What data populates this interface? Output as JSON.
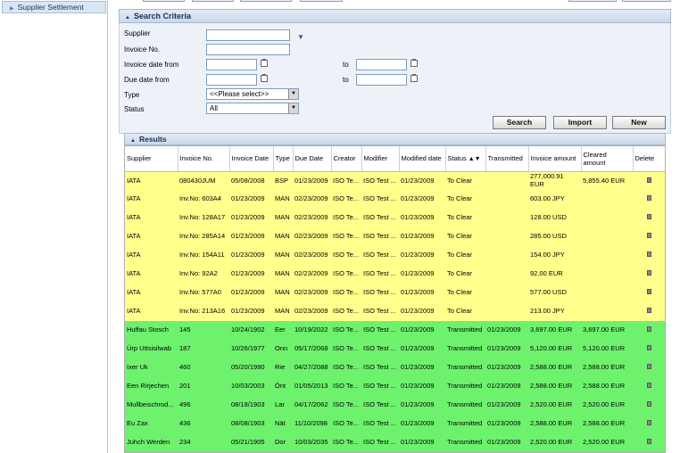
{
  "sidebar": {
    "item": "Supplier Settlement"
  },
  "criteria": {
    "title": "Search Criteria",
    "supplier_label": "Supplier",
    "invoice_no_label": "Invoice No.",
    "invoice_date_label": "Invoice date from",
    "due_date_label": "Due date from",
    "to_label": "to",
    "type_label": "Type",
    "status_label": "Status",
    "type_value": "<<Please select>>",
    "status_value": "All"
  },
  "buttons": {
    "search": "Search",
    "import": "Import",
    "new": "New"
  },
  "results": {
    "title": "Results",
    "headers": [
      "Supplier",
      "Invoice No.",
      "Invoice Date",
      "Type",
      "Due Date",
      "Creator",
      "Modifier",
      "Modified date",
      "Status",
      "Transmitted",
      "Invoice amount",
      "Cleared amount",
      "Delete"
    ],
    "rows": [
      [
        "IATA",
        "080430JUM",
        "05/08/2008",
        "BSP",
        "01/23/2009",
        "ISO Te...",
        "ISO Test ...",
        "01/23/2009",
        "To Clear",
        "",
        "277,000.91 EUR",
        "5,855.40 EUR"
      ],
      [
        "IATA",
        "Inv.No: 603A4",
        "01/23/2009",
        "MAN",
        "02/23/2009",
        "ISO Te...",
        "ISO Test ...",
        "01/23/2009",
        "To Clear",
        "",
        "603.00 JPY",
        ""
      ],
      [
        "IATA",
        "Inv.No: 128A17",
        "01/23/2009",
        "MAN",
        "02/23/2009",
        "ISO Te...",
        "ISO Test ...",
        "01/23/2009",
        "To Clear",
        "",
        "128.00 USD",
        ""
      ],
      [
        "IATA",
        "Inv.No: 285A14",
        "01/23/2009",
        "MAN",
        "02/23/2009",
        "ISO Te...",
        "ISO Test ...",
        "01/23/2009",
        "To Clear",
        "",
        "285.00 USD",
        ""
      ],
      [
        "IATA",
        "Inv.No: 154A11",
        "01/23/2009",
        "MAN",
        "02/23/2009",
        "ISO Te...",
        "ISO Test ...",
        "01/23/2009",
        "To Clear",
        "",
        "154.00 JPY",
        ""
      ],
      [
        "IATA",
        "Inv.No: 92A2",
        "01/23/2009",
        "MAN",
        "02/23/2009",
        "ISO Te...",
        "ISO Test ...",
        "01/23/2009",
        "To Clear",
        "",
        "92.00 EUR",
        ""
      ],
      [
        "IATA",
        "Inv.No: 577A0",
        "01/23/2009",
        "MAN",
        "02/23/2009",
        "ISO Te...",
        "ISO Test ...",
        "01/23/2009",
        "To Clear",
        "",
        "577.00 USD",
        ""
      ],
      [
        "IATA",
        "Inv.No: 213A16",
        "01/23/2009",
        "MAN",
        "02/23/2009",
        "ISO Te...",
        "ISO Test ...",
        "01/23/2009",
        "To Clear",
        "",
        "213.00 JPY",
        ""
      ],
      [
        "Huffau Stosch",
        "145",
        "10/24/1902",
        "Eer",
        "10/19/2022",
        "ISO Te...",
        "ISO Test ...",
        "01/23/2009",
        "Transmitted",
        "01/23/2009",
        "3,697.00 EUR",
        "3,697.00 EUR"
      ],
      [
        "Ürp Uttsisilwab",
        "187",
        "10/26/1977",
        "Onn",
        "05/17/2068",
        "ISO Te...",
        "ISO Test ...",
        "01/23/2009",
        "Transmitted",
        "01/23/2009",
        "5,120.00 EUR",
        "5,120.00 EUR"
      ],
      [
        "Ixer Uk",
        "460",
        "05/20/1990",
        "Rie",
        "04/27/2088",
        "ISO Te...",
        "ISO Test ...",
        "01/23/2009",
        "Transmitted",
        "01/23/2009",
        "2,588.00 EUR",
        "2,588.00 EUR"
      ],
      [
        "Een Rirjechen",
        "201",
        "10/03/2003",
        "Önt",
        "01/05/2013",
        "ISO Te...",
        "ISO Test ...",
        "01/23/2009",
        "Transmitted",
        "01/23/2009",
        "2,588.00 EUR",
        "2,588.00 EUR"
      ],
      [
        "Mullbeischrod...",
        "496",
        "08/18/1903",
        "Lar",
        "04/17/2062",
        "ISO Te...",
        "ISO Test ...",
        "01/23/2009",
        "Transmitted",
        "01/23/2009",
        "2,520.00 EUR",
        "2,520.00 EUR"
      ],
      [
        "Eu Zax",
        "436",
        "08/08/1903",
        "Nät",
        "11/10/2098",
        "ISO Te...",
        "ISO Test ...",
        "01/23/2009",
        "Transmitted",
        "01/23/2009",
        "2,588.00 EUR",
        "2,588.00 EUR"
      ],
      [
        "Juhch Werden",
        "234",
        "05/21/1905",
        "Dor",
        "10/03/2035",
        "ISO Te...",
        "ISO Test ...",
        "01/23/2009",
        "Transmitted",
        "01/23/2009",
        "2,520.00 EUR",
        "2,520.00 EUR"
      ]
    ]
  }
}
